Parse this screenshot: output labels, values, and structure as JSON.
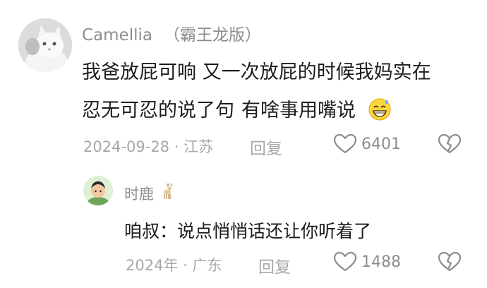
{
  "comment": {
    "username": "Camellia",
    "username_tag": "（霸王龙版）",
    "avatar": "cat-avatar",
    "text_line1": "我爸放屁可响 又一次放屁的时候我妈实在",
    "text_line2_a": "忍无可忍的说了句",
    "text_line2_b": "有啥事用嘴说",
    "emoji": "grinning-sweat-emoji",
    "date": "2024-09-28",
    "sep": "·",
    "location": "江苏",
    "reply_label": "回复",
    "likes": "6401",
    "like_icon": "heart-outline-icon",
    "dislike_icon": "broken-heart-icon"
  },
  "reply": {
    "username": "时鹿",
    "username_icon": "deer-icon",
    "avatar": "person-avatar",
    "text": "咱叔：说点悄悄话还让你听着了",
    "date": "2024年",
    "sep": "·",
    "location": "广东",
    "reply_label": "回复",
    "likes": "1488",
    "like_icon": "heart-outline-icon",
    "dislike_icon": "broken-heart-icon"
  },
  "colors": {
    "text_primary": "#1c1c1c",
    "text_secondary": "#8d8d8d",
    "text_meta": "#a7a7a7",
    "background": "#ffffff"
  }
}
